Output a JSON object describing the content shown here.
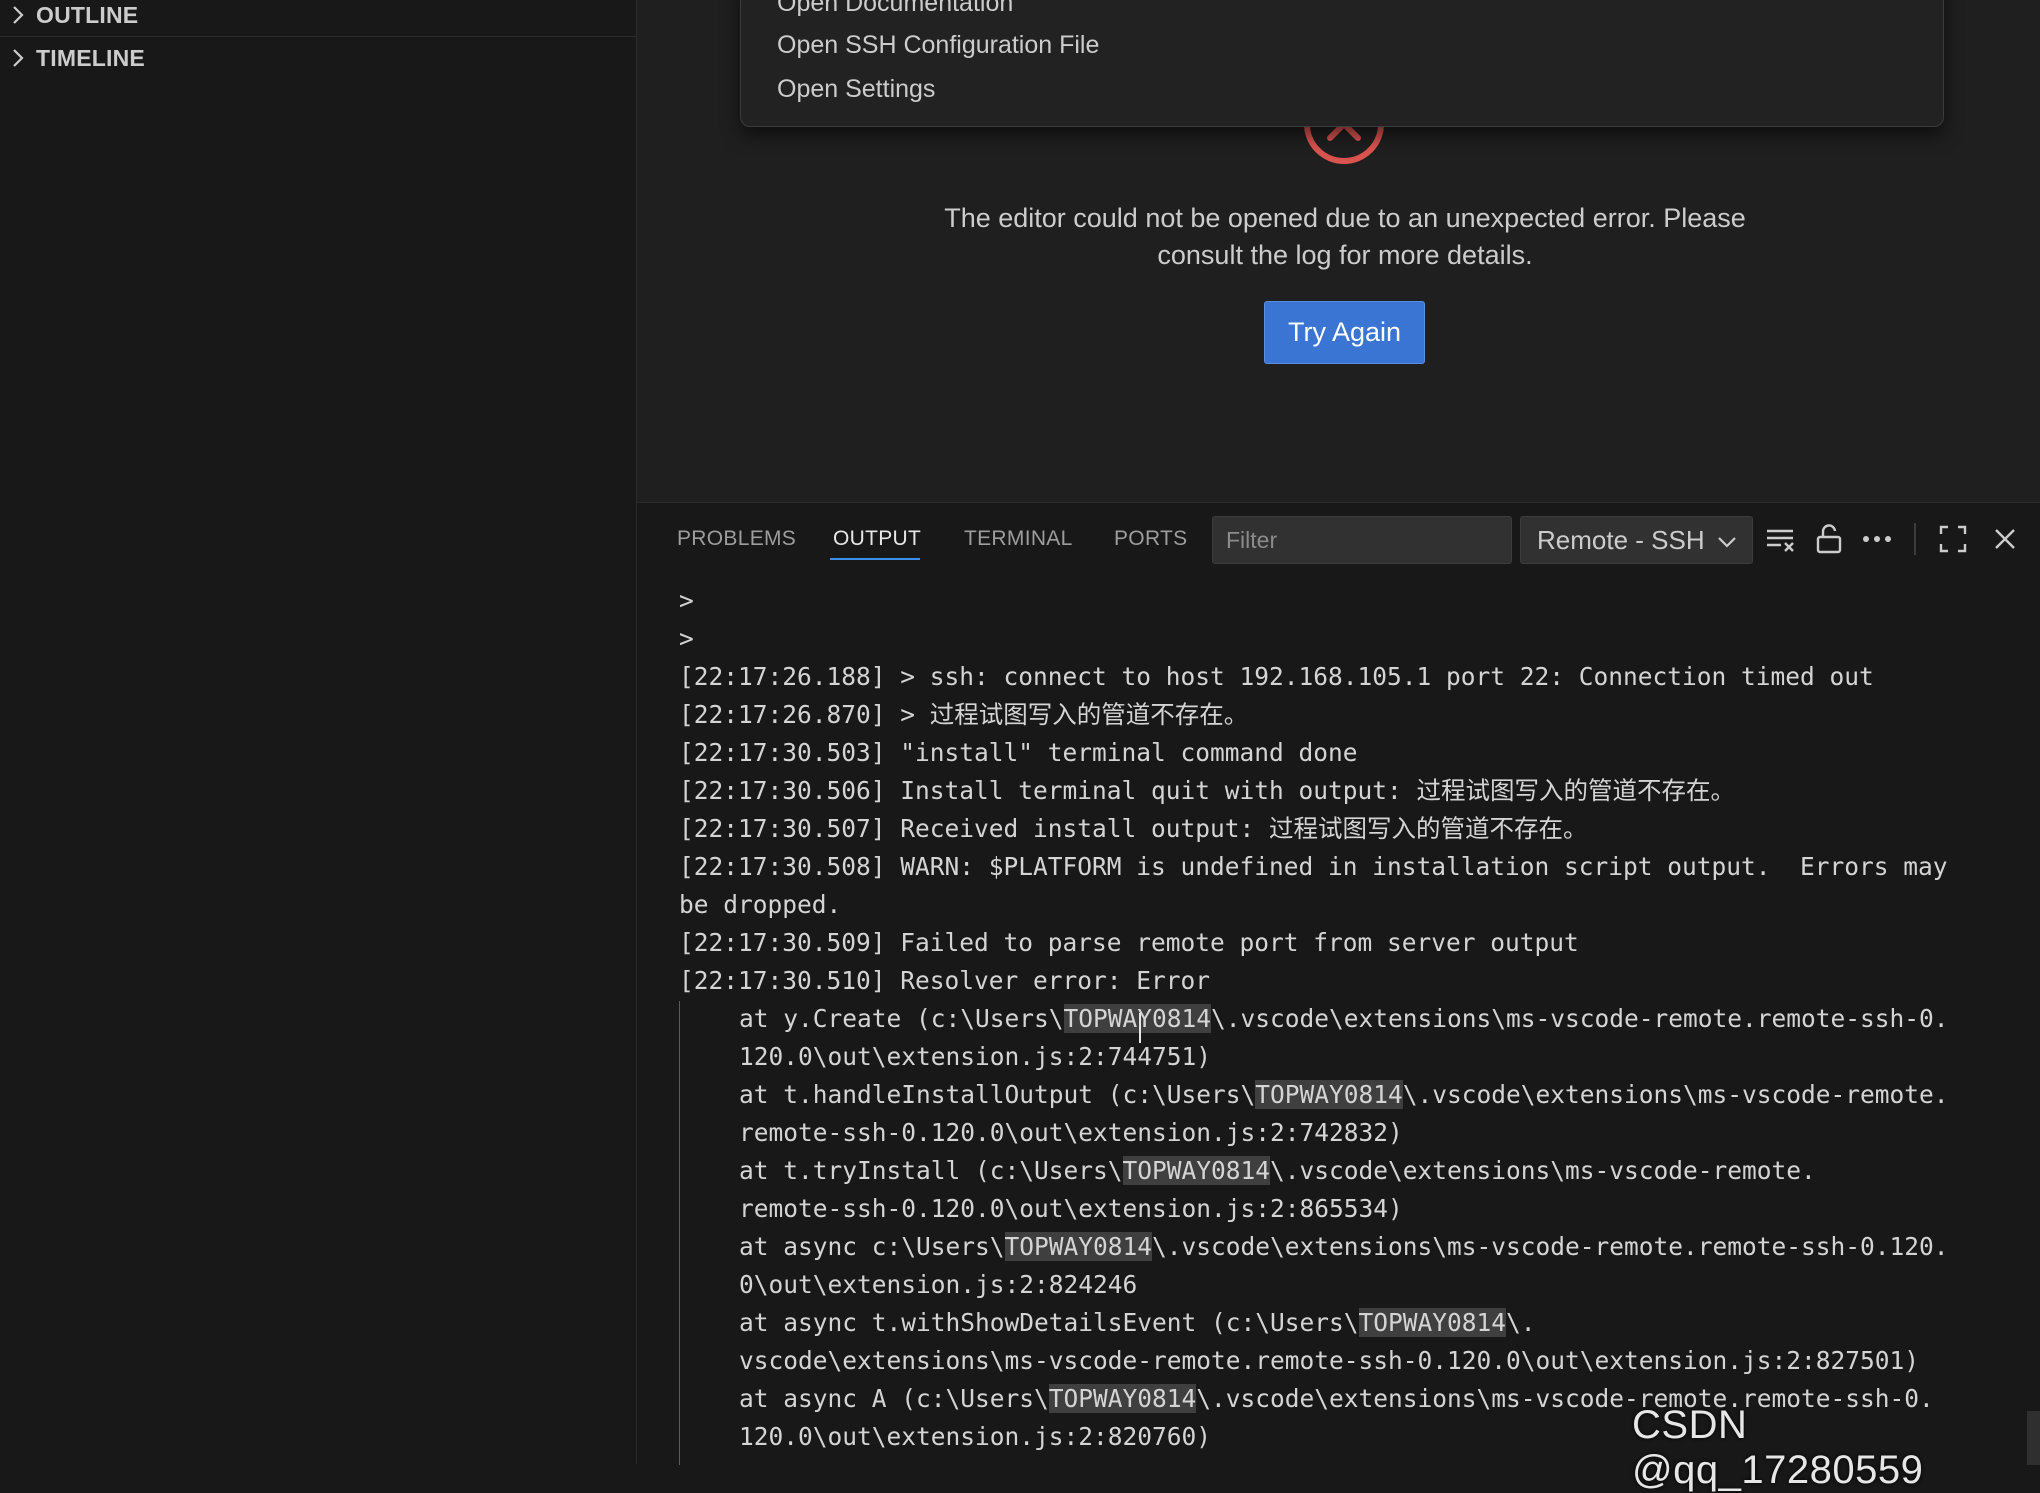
{
  "sidebar": {
    "sections": [
      {
        "label": "OUTLINE"
      },
      {
        "label": "TIMELINE"
      }
    ]
  },
  "quick_pick": {
    "items": [
      "Open Documentation",
      "Open SSH Configuration File",
      "Open Settings"
    ]
  },
  "editor": {
    "error_message_line1": "The editor could not be opened due to an unexpected error. Please",
    "error_message_line2": "consult the log for more details.",
    "try_again_label": "Try Again"
  },
  "panel": {
    "tabs": [
      "PROBLEMS",
      "OUTPUT",
      "TERMINAL",
      "PORTS"
    ],
    "active_tab": "OUTPUT",
    "filter_placeholder": "Filter",
    "channel": "Remote - SSH",
    "log_lines": [
      ">",
      ">",
      "[22:17:26.188] > ssh: connect to host 192.168.105.1 port 22: Connection timed out",
      "[22:17:26.870] > 过程试图写入的管道不存在。",
      "[22:17:30.503] \"install\" terminal command done",
      "[22:17:30.506] Install terminal quit with output: 过程试图写入的管道不存在。",
      "[22:17:30.507] Received install output: 过程试图写入的管道不存在。",
      "[22:17:30.508] WARN: $PLATFORM is undefined in installation script output.  Errors may",
      "be dropped.",
      "[22:17:30.509] Failed to parse remote port from server output",
      "[22:17:30.510] Resolver error: Error"
    ],
    "stack_lines": [
      {
        "pre": "at y.Create (c:\\Users\\",
        "hl": "TOPWAY0814",
        "post": "\\.vscode\\extensions\\ms-vscode-remote.remote-ssh-0."
      },
      {
        "pre": "120.0\\out\\extension.js:2:744751)",
        "hl": "",
        "post": ""
      },
      {
        "pre": "at t.handleInstallOutput (c:\\Users\\",
        "hl": "TOPWAY0814",
        "post": "\\.vscode\\extensions\\ms-vscode-remote."
      },
      {
        "pre": "remote-ssh-0.120.0\\out\\extension.js:2:742832)",
        "hl": "",
        "post": ""
      },
      {
        "pre": "at t.tryInstall (c:\\Users\\",
        "hl": "TOPWAY0814",
        "post": "\\.vscode\\extensions\\ms-vscode-remote."
      },
      {
        "pre": "remote-ssh-0.120.0\\out\\extension.js:2:865534)",
        "hl": "",
        "post": ""
      },
      {
        "pre": "at async c:\\Users\\",
        "hl": "TOPWAY0814",
        "post": "\\.vscode\\extensions\\ms-vscode-remote.remote-ssh-0.120."
      },
      {
        "pre": "0\\out\\extension.js:2:824246",
        "hl": "",
        "post": ""
      },
      {
        "pre": "at async t.withShowDetailsEvent (c:\\Users\\",
        "hl": "TOPWAY0814",
        "post": "\\."
      },
      {
        "pre": "vscode\\extensions\\ms-vscode-remote.remote-ssh-0.120.0\\out\\extension.js:2:827501)",
        "hl": "",
        "post": ""
      },
      {
        "pre": "at async A (c:\\Users\\",
        "hl": "TOPWAY0814",
        "post": "\\.vscode\\extensions\\ms-vscode-remote.remote-ssh-0."
      },
      {
        "pre": "120.0\\out\\extension.js:2:820760)",
        "hl": "",
        "post": ""
      }
    ]
  },
  "watermark": "CSDN @qq_17280559",
  "colors": {
    "accent": "#3b75d4",
    "error_red": "#d9534f",
    "tab_underline": "#3b8eea"
  }
}
